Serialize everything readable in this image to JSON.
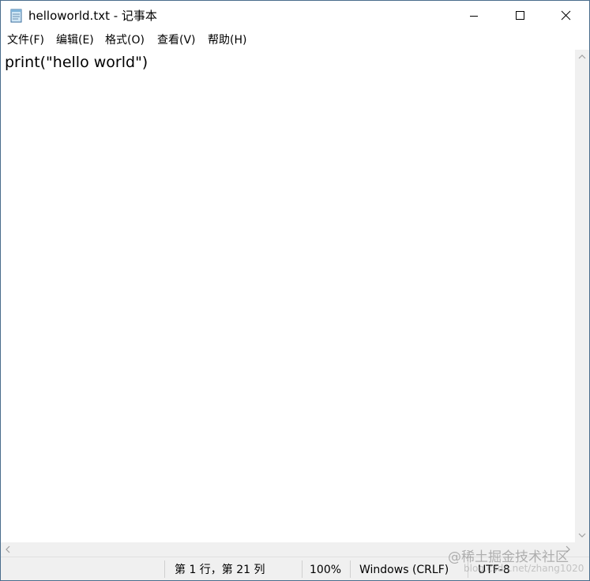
{
  "window": {
    "title": "helloworld.txt - 记事本"
  },
  "menu": {
    "items": [
      "文件(F)",
      "编辑(E)",
      "格式(O)",
      "查看(V)",
      "帮助(H)"
    ]
  },
  "editor": {
    "content": "print(\"hello world\")"
  },
  "status": {
    "position": "第 1 行，第 21 列",
    "zoom": "100%",
    "line_ending": "Windows (CRLF)",
    "encoding": "UTF-8"
  },
  "watermark": {
    "text": "@稀土掘金技术社区",
    "sub_text": "blog.csdn.net/zhang1020"
  },
  "icons": {
    "app": "notepad-icon",
    "minimize": "minimize-icon",
    "maximize": "maximize-icon",
    "close": "close-icon"
  },
  "colors": {
    "window_border": "#4a6d8c",
    "chrome_gray": "#f0f0f0"
  }
}
